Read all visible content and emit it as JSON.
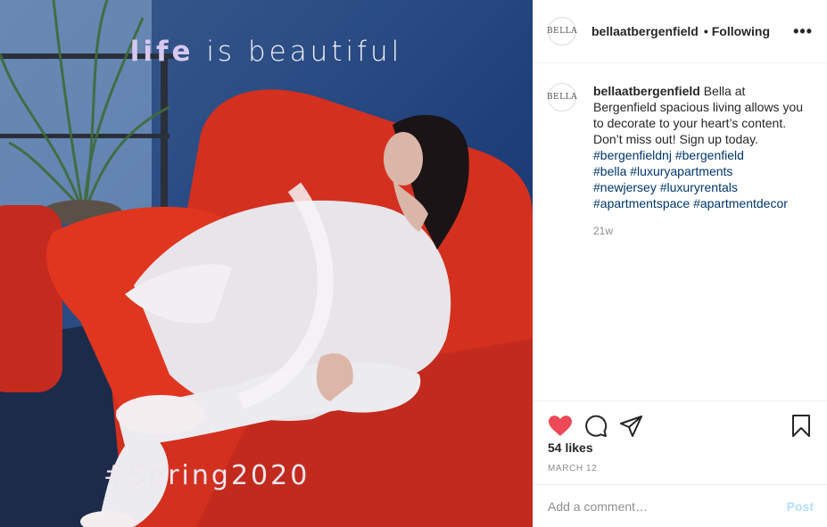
{
  "post": {
    "image_alt": "Woman in white lounging on a red sofa",
    "overlay_word_1": "life",
    "overlay_rest": " is beautiful",
    "overlay_hashtag": "#Spring2020"
  },
  "header": {
    "avatar_text": "BELLA",
    "username": "bellaatbergenfield",
    "separator": "•",
    "follow_status": "Following",
    "more_icon": "more-horizontal-icon"
  },
  "caption": {
    "avatar_text": "BELLA",
    "username": "bellaatbergenfield",
    "text": " Bella at Bergenfield spacious living allows you to decorate to your heart’s content. Don’t miss out! Sign up today.",
    "hashtags": [
      "#bergenfieldnj",
      "#bergenfield",
      "#bella",
      "#luxuryapartments",
      "#newjersey",
      "#luxuryrentals",
      "#apartmentspace",
      "#apartmentdecor"
    ],
    "time_ago": "21w"
  },
  "actions": {
    "like_icon": "heart-filled-icon",
    "comment_icon": "comment-icon",
    "share_icon": "share-icon",
    "save_icon": "bookmark-icon",
    "like_color": "#ed4956"
  },
  "stats": {
    "likes": "54 likes",
    "date": "MARCH 12"
  },
  "comment": {
    "placeholder": "Add a comment…",
    "post_label": "Post"
  }
}
